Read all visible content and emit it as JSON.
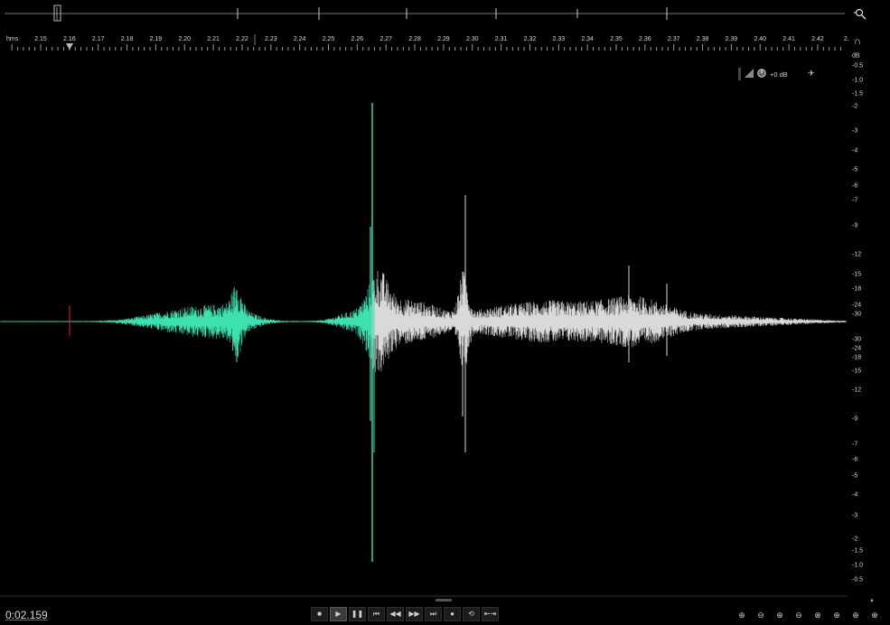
{
  "ruler": {
    "unit_label": "hms",
    "ticks": [
      "2.15",
      "2.16",
      "2.17",
      "2.18",
      "2.19",
      "2.20",
      "2.21",
      "2.22",
      "2.23",
      "2.24",
      "2.25",
      "2.26",
      "2.27",
      "2.28",
      "2.29",
      "2.30",
      "2.31",
      "2.32",
      "2.33",
      "2.34",
      "2.35",
      "2.36",
      "2.37",
      "2.38",
      "2.39",
      "2.40",
      "2.41",
      "2.42",
      "2."
    ]
  },
  "db_scale": {
    "unit": "dB",
    "upper": [
      "-0.5",
      "-1.0",
      "-1.5",
      "-2",
      "-3",
      "-4",
      "-5",
      "-6",
      "-7",
      "-9",
      "-12",
      "-15",
      "-18",
      "-24",
      "-30"
    ],
    "lower": [
      "-30",
      "-24",
      "-18",
      "-15",
      "-12",
      "-9",
      "-7",
      "-6",
      "-5",
      "-4",
      "-3",
      "-2",
      "-1.5",
      "-1.0",
      "-0.5"
    ]
  },
  "hud": {
    "gain_label": "+0 dB"
  },
  "status": {
    "time": "0:02.159"
  },
  "transport": {
    "buttons": [
      {
        "name": "stop-button",
        "glyph": "■"
      },
      {
        "name": "play-button",
        "glyph": "▶"
      },
      {
        "name": "pause-button",
        "glyph": "❚❚"
      },
      {
        "name": "go-to-start-button",
        "glyph": "⏮"
      },
      {
        "name": "rewind-button",
        "glyph": "◀◀"
      },
      {
        "name": "fast-forward-button",
        "glyph": "▶▶"
      },
      {
        "name": "go-to-end-button",
        "glyph": "⏭"
      },
      {
        "name": "record-button",
        "glyph": "●"
      },
      {
        "name": "loop-button",
        "glyph": "⟲"
      },
      {
        "name": "skip-selection-button",
        "glyph": "⇤⇥"
      }
    ]
  },
  "zoom_tools": {
    "buttons": [
      {
        "name": "zoom-in-amplitude-button",
        "glyph": "⊕"
      },
      {
        "name": "zoom-out-amplitude-button",
        "glyph": "⊖"
      },
      {
        "name": "zoom-in-time-button",
        "glyph": "⊕"
      },
      {
        "name": "zoom-out-time-button",
        "glyph": "⊖"
      },
      {
        "name": "zoom-out-full-button",
        "glyph": "⊗"
      },
      {
        "name": "zoom-in-left-button",
        "glyph": "⊕"
      },
      {
        "name": "zoom-in-right-button",
        "glyph": "⊕"
      },
      {
        "name": "zoom-selection-button",
        "glyph": "⊕"
      }
    ]
  },
  "colors": {
    "waveform_selected": "#3fe0b0",
    "waveform_unselected": "#d9d9d9",
    "playhead": "#c0202a",
    "centerline": "#6a6a6a",
    "background": "#000000"
  },
  "icons": {
    "overview_zoom": "zoom-magnifier-icon",
    "snap": "magnet-icon",
    "hud_pin": "pin-icon"
  }
}
